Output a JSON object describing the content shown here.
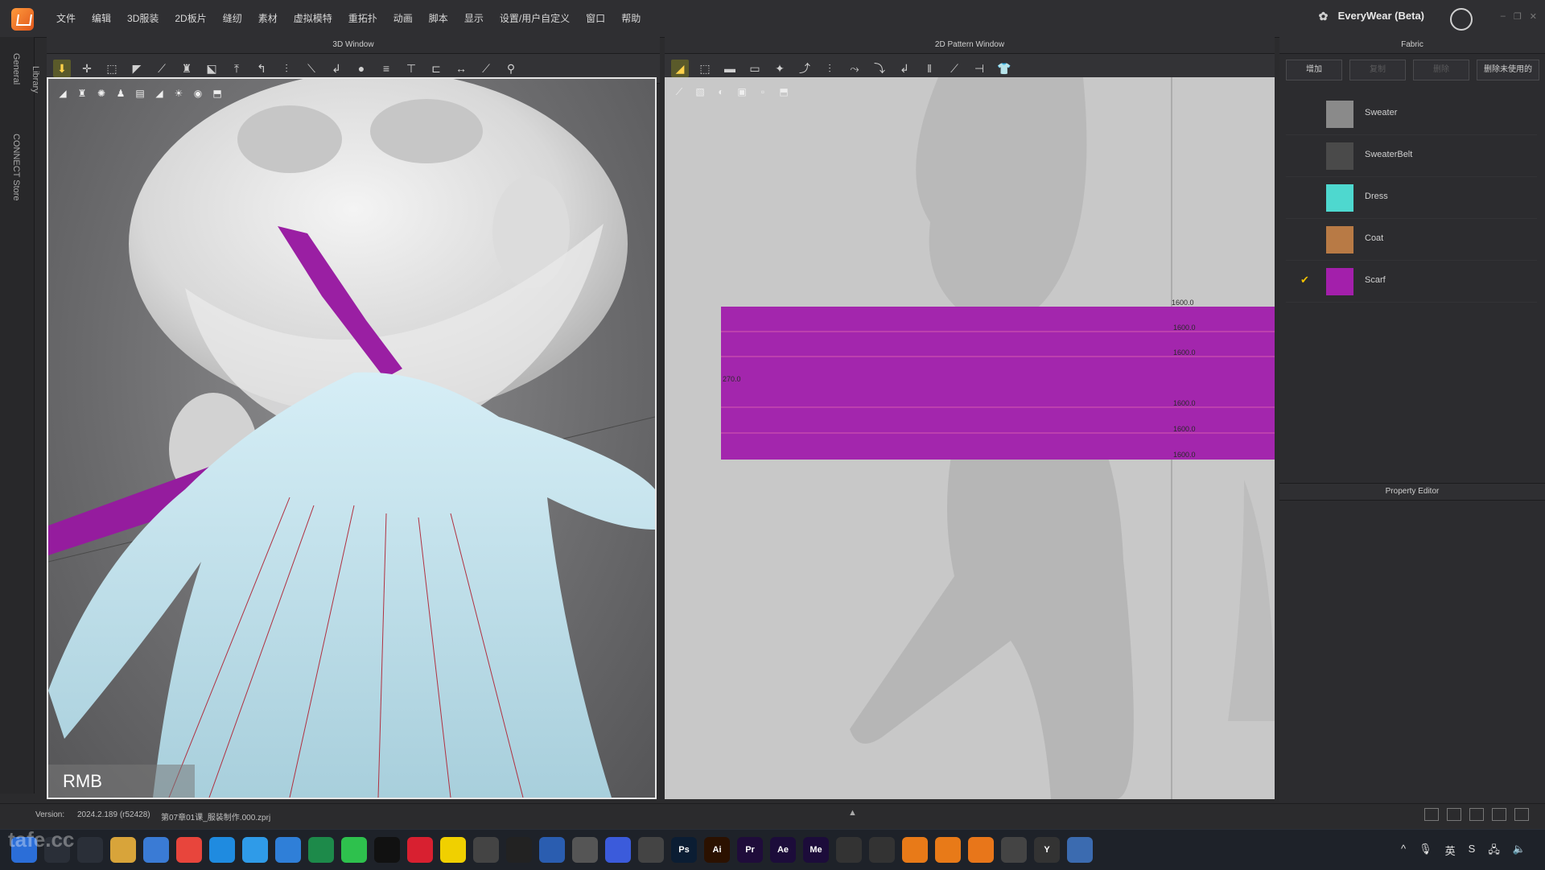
{
  "menu": [
    "文件",
    "编辑",
    "3D服装",
    "2D板片",
    "缝纫",
    "素材",
    "虚拟模特",
    "重拓扑",
    "动画",
    "脚本",
    "显示",
    "设置/用户自定义",
    "窗口",
    "帮助"
  ],
  "product": {
    "name": "EveryWear (Beta)"
  },
  "sidebar": {
    "tabs": [
      "General",
      "Library",
      "CONNECT Store"
    ]
  },
  "window3d": {
    "title": "3D Window",
    "overlay_text": "RMB"
  },
  "window2d": {
    "title": "2D Pattern Window",
    "measurements": [
      "1600.0",
      "1600.0",
      "1600.0",
      "270.0",
      "1600.0",
      "1600.0",
      "1600.0"
    ]
  },
  "fabric": {
    "title": "Fabric",
    "buttons": [
      "增加",
      "复制",
      "删除",
      "删除未使用的"
    ],
    "items": [
      {
        "name": "Sweater",
        "color": "#8a8a8a",
        "selected": false
      },
      {
        "name": "SweaterBelt",
        "color": "#4a4a4a",
        "selected": false
      },
      {
        "name": "Dress",
        "color": "#4ed8cf",
        "selected": false
      },
      {
        "name": "Coat",
        "color": "#b87a45",
        "selected": false
      },
      {
        "name": "Scarf",
        "color": "#a31fab",
        "selected": true
      }
    ]
  },
  "property_editor": {
    "title": "Property Editor"
  },
  "status": {
    "version_label": "Version:",
    "version": "2024.2.189 (r52428)",
    "file": "第07章01课_服装制作.000.zprj"
  },
  "watermark": "tafe.cc",
  "taskbar": {
    "apps": [
      "win",
      "search",
      "task",
      "files",
      "store",
      "chrome",
      "edge",
      "photos",
      "vscode",
      "excel",
      "wechat",
      "qq",
      "netease",
      "notes",
      "tool",
      "jb",
      "word",
      "settings",
      "paint",
      "ai-tool",
      "Ps",
      "Ai",
      "Pr",
      "Ae",
      "Me",
      "c4d",
      "c4d2",
      "blender",
      "blender2",
      "clo",
      "chrome2",
      "Y",
      "calc"
    ],
    "tray": [
      "^",
      "mic",
      "英",
      "S",
      "net",
      "vol"
    ]
  },
  "colors": {
    "scarf": "#a31fab",
    "dress": "#cfe9f2"
  }
}
